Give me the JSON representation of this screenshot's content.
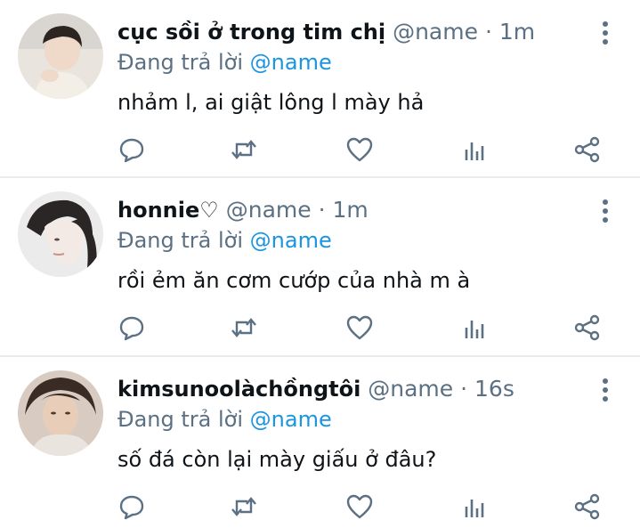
{
  "tweets": [
    {
      "display_name": "cục sồi ở trong tim chị",
      "handle": "@name",
      "separator": "·",
      "time": "1m",
      "replying_label": "Đang trả lời",
      "replying_to": "@name",
      "text": "nhảm l, ai giật lông l mày hả"
    },
    {
      "display_name": "honnie♡",
      "handle": "@name",
      "separator": "·",
      "time": "1m",
      "replying_label": "Đang trả lời",
      "replying_to": "@name",
      "text": "rồi ẻm ăn cơm cướp của nhà m à"
    },
    {
      "display_name": "kimsunoolàchồngtôi",
      "handle": "@name",
      "separator": "·",
      "time": "16s",
      "replying_label": "Đang trả lời",
      "replying_to": "@name",
      "text": "số đá còn lại mày giấu ở đâu?"
    }
  ],
  "icons": {
    "reply": "reply-icon",
    "retweet": "retweet-icon",
    "like": "like-icon",
    "analytics": "analytics-icon",
    "share": "share-icon",
    "more": "more-options-icon"
  },
  "colors": {
    "icon_gray": "#5b7083",
    "mention_blue": "#1b95e0",
    "divider": "#e6ecf0"
  }
}
